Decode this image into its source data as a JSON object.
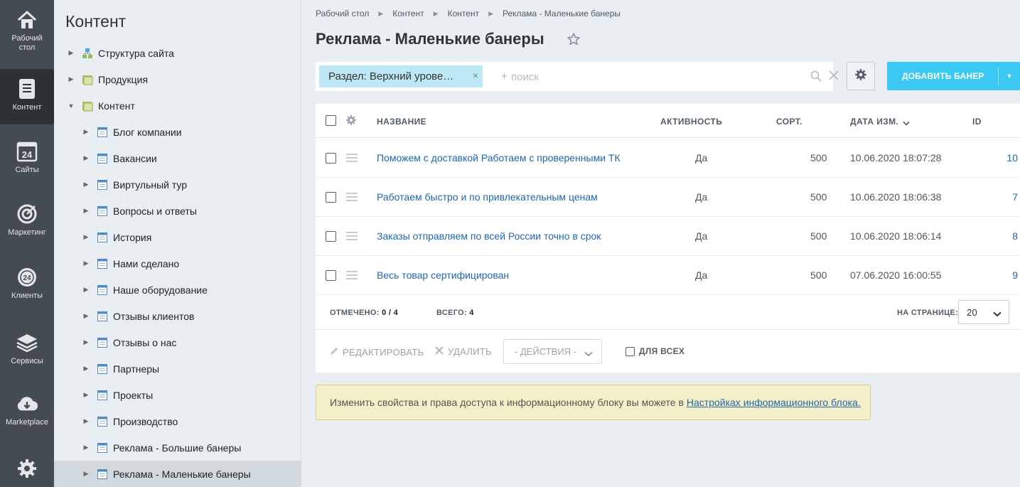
{
  "rail": {
    "items": [
      {
        "label": "Рабочий\nстол",
        "icon": "home-icon"
      },
      {
        "label": "Контент",
        "icon": "document-icon"
      },
      {
        "label": "Сайты",
        "icon": "calendar-24-icon"
      },
      {
        "label": "Маркетинг",
        "icon": "target-icon"
      },
      {
        "label": "Клиенты",
        "icon": "clients-24-icon"
      },
      {
        "label": "Сервисы",
        "icon": "layers-icon"
      },
      {
        "label": "Marketplace",
        "icon": "cloud-download-icon"
      }
    ],
    "settings_icon": "gear-icon"
  },
  "tree": {
    "title": "Контент",
    "items": [
      {
        "label": "Структура сайта",
        "icon": "structure-icon",
        "level": 0,
        "expanded": false
      },
      {
        "label": "Продукция",
        "icon": "folder-icon",
        "level": 0,
        "expanded": false
      },
      {
        "label": "Контент",
        "icon": "folder-icon",
        "level": 0,
        "expanded": true
      },
      {
        "label": "Блог компании",
        "icon": "block-icon",
        "level": 1
      },
      {
        "label": "Вакансии",
        "icon": "block-icon",
        "level": 1
      },
      {
        "label": "Виртульный тур",
        "icon": "block-icon",
        "level": 1
      },
      {
        "label": "Вопросы и ответы",
        "icon": "block-icon",
        "level": 1
      },
      {
        "label": "История",
        "icon": "block-icon",
        "level": 1
      },
      {
        "label": "Нами сделано",
        "icon": "block-icon",
        "level": 1
      },
      {
        "label": "Наше оборудование",
        "icon": "block-icon",
        "level": 1
      },
      {
        "label": "Отзывы клиентов",
        "icon": "block-icon",
        "level": 1
      },
      {
        "label": "Отзывы о нас",
        "icon": "block-icon",
        "level": 1
      },
      {
        "label": "Партнеры",
        "icon": "block-icon",
        "level": 1
      },
      {
        "label": "Проекты",
        "icon": "block-icon",
        "level": 1
      },
      {
        "label": "Производство",
        "icon": "block-icon",
        "level": 1
      },
      {
        "label": "Реклама - Большие банеры",
        "icon": "block-icon",
        "level": 1
      },
      {
        "label": "Реклама - Маленькие банеры",
        "icon": "block-icon",
        "level": 1,
        "active": true
      }
    ]
  },
  "breadcrumbs": [
    "Рабочий стол",
    "Контент",
    "Контент",
    "Реклама - Маленькие банеры"
  ],
  "page": {
    "title": "Реклама - Маленькие банеры"
  },
  "filter": {
    "tag_label": "Раздел: Верхний урове…",
    "tag_close": "×",
    "plus": "+",
    "placeholder": "поиск",
    "clear": "✕"
  },
  "toolbar": {
    "add_label": "ДОБАВИТЬ БАНЕР"
  },
  "table": {
    "columns": {
      "name": "НАЗВАНИЕ",
      "active": "АКТИВНОСТЬ",
      "sort": "СОРТ.",
      "date": "ДАТА ИЗМ.",
      "id": "ID"
    },
    "rows": [
      {
        "name": "Поможем с доставкой Работаем с проверенными ТК",
        "active": "Да",
        "sort": "500",
        "date": "10.06.2020 18:07:28",
        "id": "10"
      },
      {
        "name": "Работаем быстро и по привлекательным ценам",
        "active": "Да",
        "sort": "500",
        "date": "10.06.2020 18:06:38",
        "id": "7"
      },
      {
        "name": "Заказы отправляем по всей России точно в срок",
        "active": "Да",
        "sort": "500",
        "date": "10.06.2020 18:06:14",
        "id": "8"
      },
      {
        "name": "Весь товар сертифицирован",
        "active": "Да",
        "sort": "500",
        "date": "07.06.2020 16:00:55",
        "id": "9"
      }
    ],
    "footer": {
      "selected_label": "ОТМЕЧЕНО:",
      "selected_value": "0 / 4",
      "total_label": "ВСЕГО:",
      "total_value": "4",
      "perpage_label": "НА СТРАНИЦЕ:",
      "perpage_value": "20"
    },
    "actions": {
      "edit": "РЕДАКТИРОВАТЬ",
      "delete": "УДАЛИТЬ",
      "select": "- ДЕЙСТВИЯ -",
      "forall": "ДЛЯ ВСЕХ"
    }
  },
  "notice": {
    "text": "Изменить свойства и права доступа к информационному блоку вы можете в",
    "link": "Настройках информационного блока."
  },
  "colors": {
    "accent": "#3bc8f5",
    "link": "#2067b0",
    "rail_bg": "#454b52",
    "notice_bg": "#f4efc7"
  }
}
